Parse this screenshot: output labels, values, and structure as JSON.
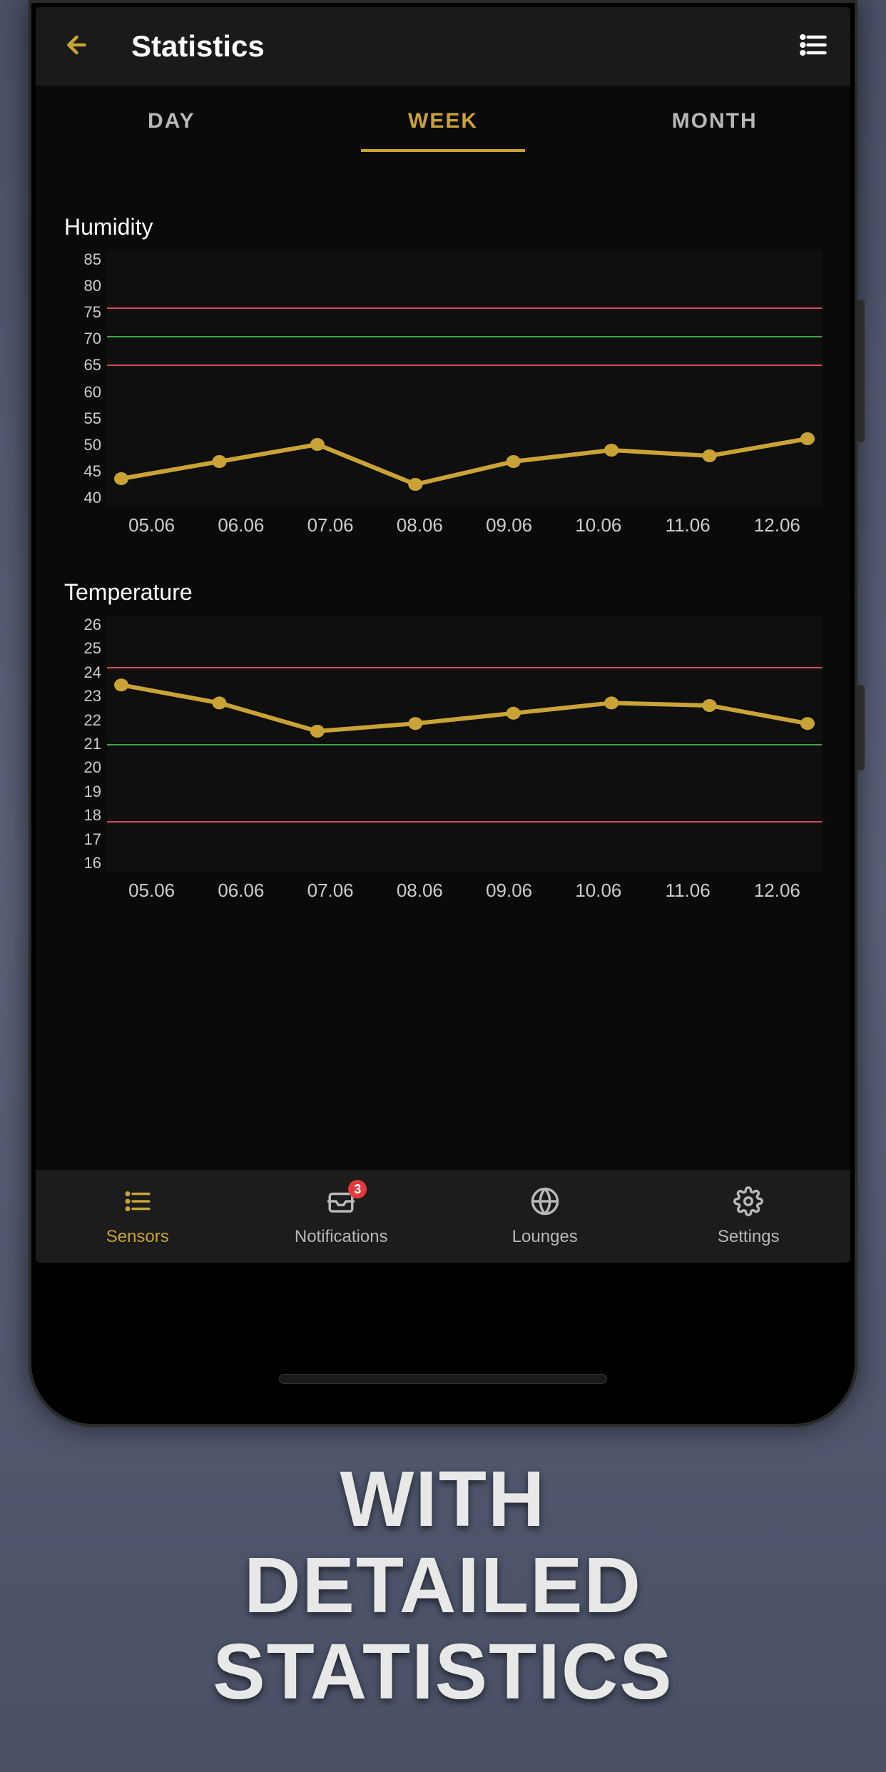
{
  "header": {
    "title": "Statistics"
  },
  "tabs": [
    {
      "label": "DAY",
      "active": false
    },
    {
      "label": "WEEK",
      "active": true
    },
    {
      "label": "MONTH",
      "active": false
    }
  ],
  "charts": {
    "humidity": {
      "title": "Humidity"
    },
    "temperature": {
      "title": "Temperature"
    }
  },
  "chart_data": [
    {
      "type": "line",
      "title": "Humidity",
      "xlabel": "",
      "ylabel": "",
      "ylim": [
        40,
        85
      ],
      "y_ticks": [
        85,
        80,
        75,
        70,
        65,
        60,
        55,
        50,
        45,
        40
      ],
      "categories": [
        "05.06",
        "06.06",
        "07.06",
        "08.06",
        "09.06",
        "10.06",
        "11.06",
        "12.06"
      ],
      "values": [
        45,
        48,
        51,
        44,
        48,
        50,
        49,
        52
      ],
      "thresholds": [
        {
          "value": 75,
          "color": "red"
        },
        {
          "value": 70,
          "color": "green"
        },
        {
          "value": 65,
          "color": "red"
        }
      ]
    },
    {
      "type": "line",
      "title": "Temperature",
      "xlabel": "",
      "ylabel": "",
      "ylim": [
        16,
        26
      ],
      "y_ticks": [
        26,
        25,
        24,
        23,
        22,
        21,
        20,
        19,
        18,
        17,
        16
      ],
      "categories": [
        "05.06",
        "06.06",
        "07.06",
        "08.06",
        "09.06",
        "10.06",
        "11.06",
        "12.06"
      ],
      "values": [
        23.3,
        22.6,
        21.5,
        21.8,
        22.2,
        22.6,
        22.5,
        21.8
      ],
      "thresholds": [
        {
          "value": 24,
          "color": "red"
        },
        {
          "value": 21,
          "color": "green"
        },
        {
          "value": 18,
          "color": "red"
        }
      ]
    }
  ],
  "nav": {
    "items": [
      {
        "label": "Sensors",
        "icon": "list-icon",
        "active": true
      },
      {
        "label": "Notifications",
        "icon": "inbox-icon",
        "active": false,
        "badge": "3"
      },
      {
        "label": "Lounges",
        "icon": "globe-icon",
        "active": false
      },
      {
        "label": "Settings",
        "icon": "gear-icon",
        "active": false
      }
    ]
  },
  "marketing": {
    "line1": "WITH",
    "line2": "DETAILED",
    "line3": "STATISTICS"
  },
  "colors": {
    "accent": "#c9a335",
    "threshold_high": "#d94a5a",
    "threshold_ok": "#3fa648"
  }
}
